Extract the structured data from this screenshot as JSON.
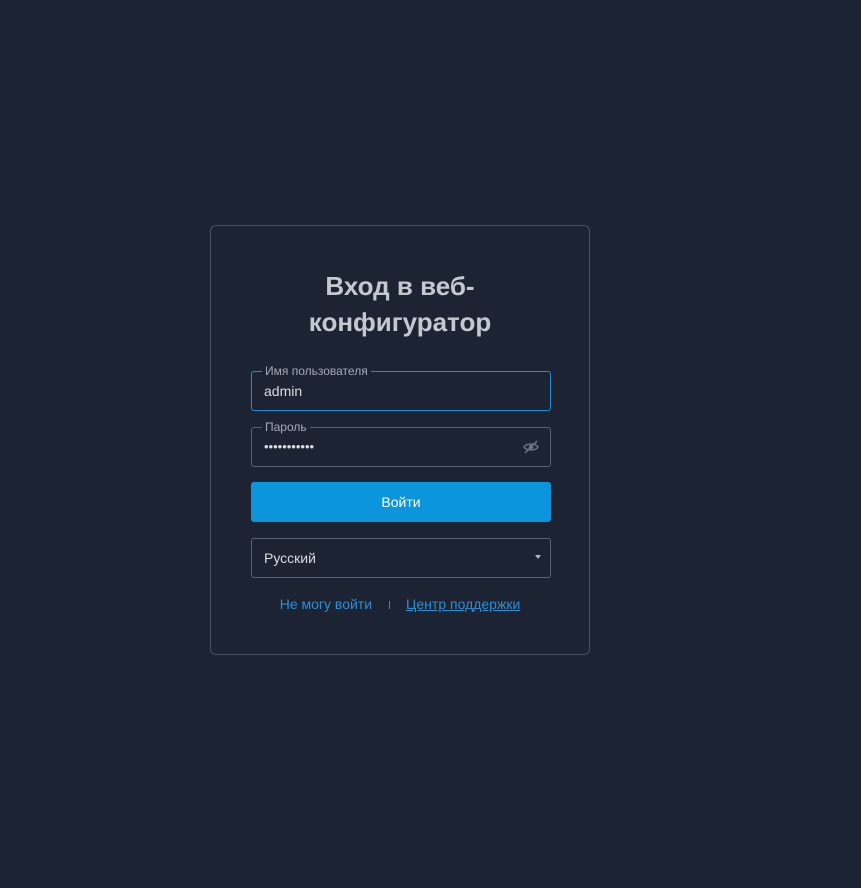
{
  "login": {
    "title": "Вход в веб-конфигуратор",
    "username": {
      "label": "Имя пользователя",
      "value": "admin"
    },
    "password": {
      "label": "Пароль",
      "value": "•••••••••••",
      "toggle_icon": "eye-off-icon"
    },
    "submit_label": "Войти",
    "language": {
      "selected": "Русский",
      "caret_icon": "caret-down-icon"
    },
    "links": {
      "cant_login": "Не могу войти",
      "support": "Центр поддержки"
    },
    "colors": {
      "background": "#1c2434",
      "accent": "#0a95dc",
      "link": "#2b8fd6"
    }
  }
}
